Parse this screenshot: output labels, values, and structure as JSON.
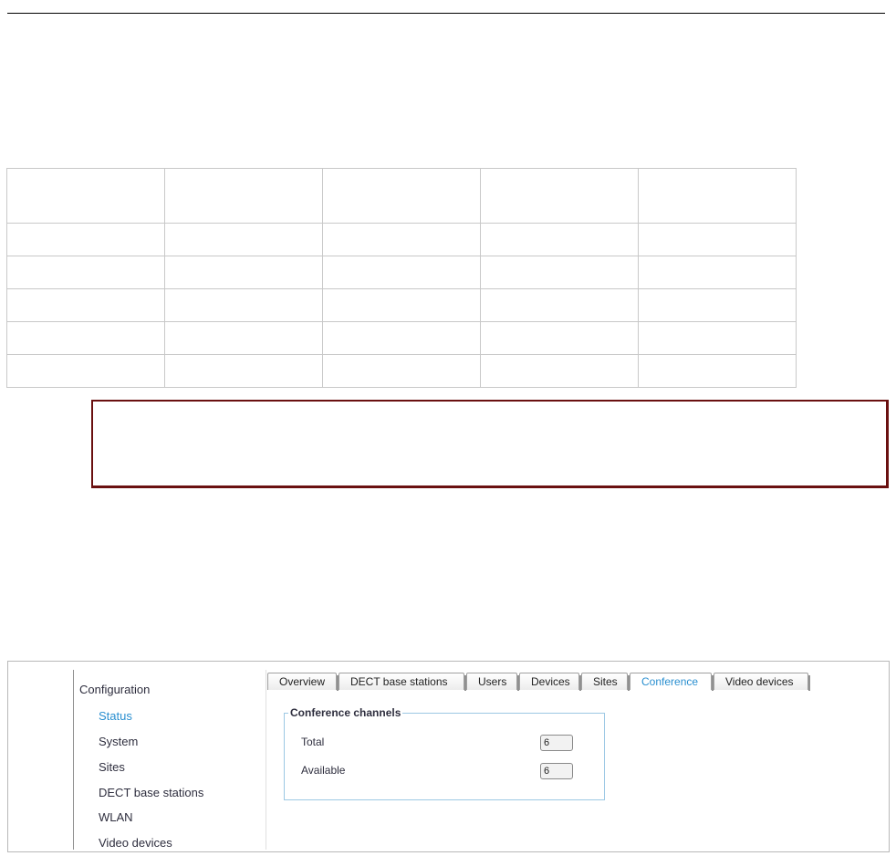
{
  "table": {
    "rows": 6,
    "columns": 5
  },
  "nav": {
    "title": "Configuration",
    "items": [
      "Status",
      "System",
      "Sites",
      "DECT base stations",
      "WLAN",
      "Video devices"
    ]
  },
  "tabs": [
    "Overview",
    "DECT base stations",
    "Users",
    "Devices",
    "Sites",
    "Conference",
    "Video devices"
  ],
  "active_tab": "Conference",
  "conference": {
    "legend": "Conference channels",
    "total_label": "Total",
    "total_value": "6",
    "available_label": "Available",
    "available_value": "6"
  },
  "colors": {
    "link_active": "#2a8fd0",
    "note_border": "#6a1010",
    "group_border": "#9cc8e4"
  }
}
